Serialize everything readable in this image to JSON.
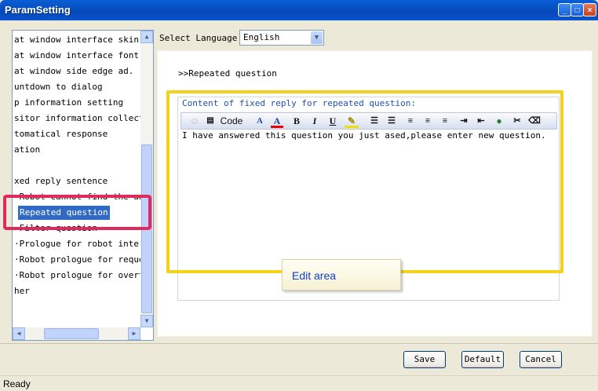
{
  "window": {
    "title": "ParamSetting",
    "controls": {
      "minimize": "_",
      "maximize": "□",
      "close": "×"
    }
  },
  "tree": {
    "items": [
      {
        "label": "at window interface skin se"
      },
      {
        "label": "at window interface font co"
      },
      {
        "label": "at window side edge ad."
      },
      {
        "label": "untdown to dialog"
      },
      {
        "label": "p information setting"
      },
      {
        "label": "sitor information collect"
      },
      {
        "label": "tomatical response"
      },
      {
        "label": "ation"
      },
      {
        "label": ""
      },
      {
        "label": "xed reply sentence"
      },
      {
        "label": "·Robot cannot find the answ"
      },
      {
        "label": "Repeated question"
      },
      {
        "label": "·Filter question"
      },
      {
        "label": "·Prologue for robot interfa"
      },
      {
        "label": "·Robot prologue for request"
      },
      {
        "label": "·Robot prologue for overtim"
      },
      {
        "label": "her"
      }
    ],
    "selected_index": 11
  },
  "language": {
    "label": "Select Language",
    "value": "English"
  },
  "section_title": ">>Repeated question",
  "editor": {
    "header": "Content of fixed reply for repeated question:",
    "toolbar": {
      "code_label": "Code",
      "icons": [
        "smiley-icon",
        "source-icon",
        "font-size-icon",
        "font-color-icon",
        "bold-icon",
        "italic-icon",
        "underline-icon",
        "highlight-icon",
        "ordered-list-icon",
        "unordered-list-icon",
        "align-left-icon",
        "align-center-icon",
        "align-right-icon",
        "indent-icon",
        "outdent-icon",
        "insert-link-icon",
        "remove-link-icon",
        "eraser-icon"
      ]
    },
    "content": "I have answered this question you just ased,please enter new question."
  },
  "annotation": {
    "callout": "Edit  area",
    "highlight_color": "#f2d21c",
    "selection_color": "#e22a5a"
  },
  "buttons": {
    "save": "Save",
    "default": "Default",
    "cancel": "Cancel"
  },
  "status": "Ready"
}
